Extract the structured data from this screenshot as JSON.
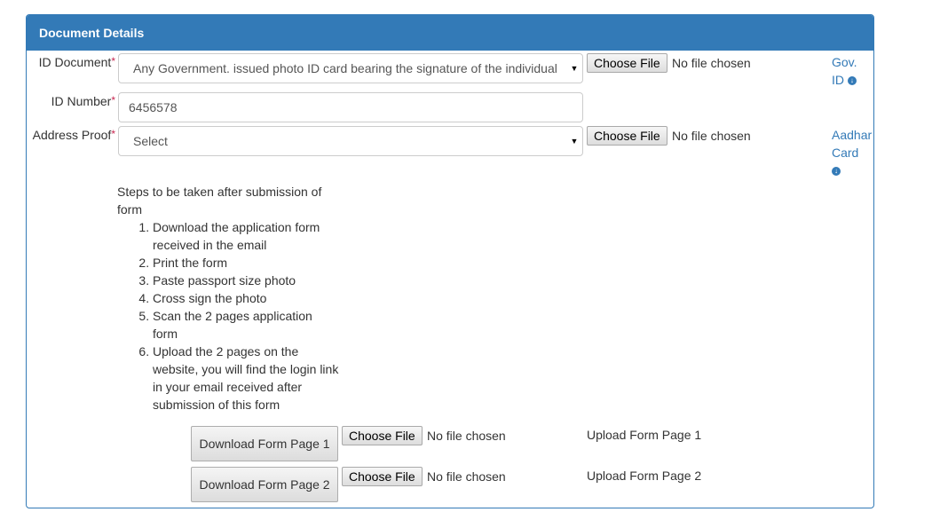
{
  "panel": {
    "title": "Document Details"
  },
  "id_document": {
    "label": "ID Document",
    "required": "*",
    "selected": "Any Government. issued photo ID card bearing the signature of the individual",
    "file_button": "Choose File",
    "file_status": "No file chosen",
    "link_line1": "Gov.",
    "link_line2": "ID"
  },
  "id_number": {
    "label": "ID Number",
    "required": "*",
    "value": "6456578"
  },
  "address_proof": {
    "label": "Address Proof",
    "required": "*",
    "selected": "Select",
    "file_button": "Choose File",
    "file_status": "No file chosen",
    "link_line1": "Aadhar",
    "link_line2": "Card"
  },
  "steps": {
    "heading": "Steps to be taken after submission of form",
    "items": [
      "Download the application form received in the email",
      "Print the form",
      "Paste passport size photo",
      "Cross sign the photo",
      "Scan the 2 pages application form",
      "Upload the 2 pages on the website, you will find the login link in your email received after submission of this form"
    ]
  },
  "forms": [
    {
      "download_label": "Download Form Page 1",
      "file_button": "Choose File",
      "file_status": "No file chosen",
      "upload_label": "Upload Form Page 1"
    },
    {
      "download_label": "Download Form Page 2",
      "file_button": "Choose File",
      "file_status": "No file chosen",
      "upload_label": "Upload Form Page 2"
    }
  ],
  "colors": {
    "primary": "#337ab7",
    "required": "#c7254e"
  }
}
